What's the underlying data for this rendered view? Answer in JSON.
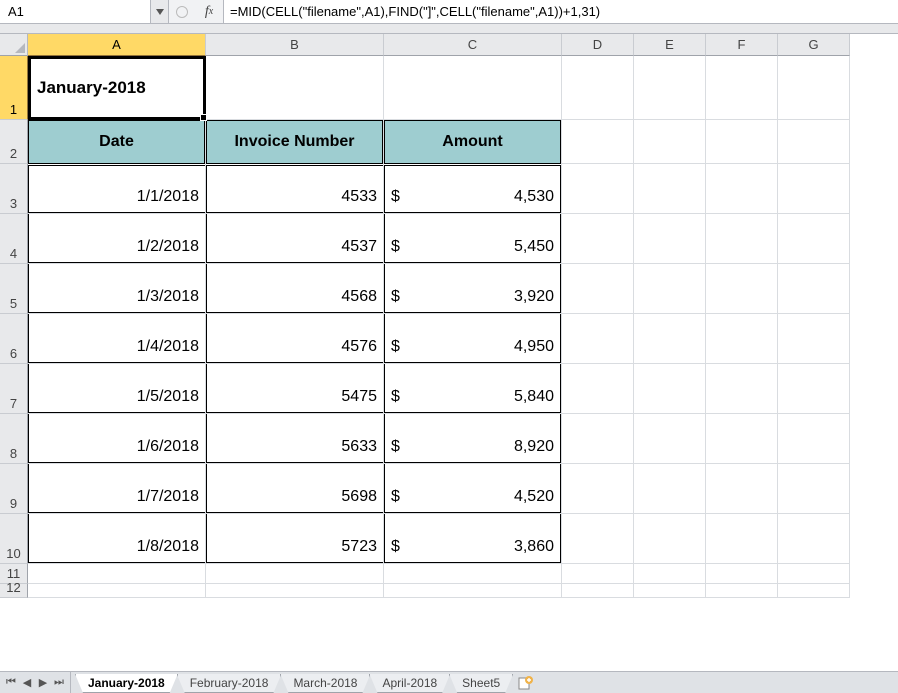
{
  "nameBox": "A1",
  "formula": "=MID(CELL(\"filename\",A1),FIND(\"]\",CELL(\"filename\",A1))+1,31)",
  "activeCellValue": "January-2018",
  "columns": [
    "A",
    "B",
    "C",
    "D",
    "E",
    "F",
    "G"
  ],
  "activeColumn": "A",
  "activeRow": 1,
  "rowNumbers": [
    1,
    2,
    3,
    4,
    5,
    6,
    7,
    8,
    9,
    10,
    11,
    12
  ],
  "headers": {
    "date": "Date",
    "invoice": "Invoice Number",
    "amount": "Amount"
  },
  "rows": [
    {
      "date": "1/1/2018",
      "invoice": "4533",
      "currency": "$",
      "amount": "4,530"
    },
    {
      "date": "1/2/2018",
      "invoice": "4537",
      "currency": "$",
      "amount": "5,450"
    },
    {
      "date": "1/3/2018",
      "invoice": "4568",
      "currency": "$",
      "amount": "3,920"
    },
    {
      "date": "1/4/2018",
      "invoice": "4576",
      "currency": "$",
      "amount": "4,950"
    },
    {
      "date": "1/5/2018",
      "invoice": "5475",
      "currency": "$",
      "amount": "5,840"
    },
    {
      "date": "1/6/2018",
      "invoice": "5633",
      "currency": "$",
      "amount": "8,920"
    },
    {
      "date": "1/7/2018",
      "invoice": "5698",
      "currency": "$",
      "amount": "4,520"
    },
    {
      "date": "1/8/2018",
      "invoice": "5723",
      "currency": "$",
      "amount": "3,860"
    }
  ],
  "tabs": [
    {
      "label": "January-2018",
      "active": true
    },
    {
      "label": "February-2018",
      "active": false
    },
    {
      "label": "March-2018",
      "active": false
    },
    {
      "label": "April-2018",
      "active": false
    },
    {
      "label": "Sheet5",
      "active": false
    }
  ]
}
